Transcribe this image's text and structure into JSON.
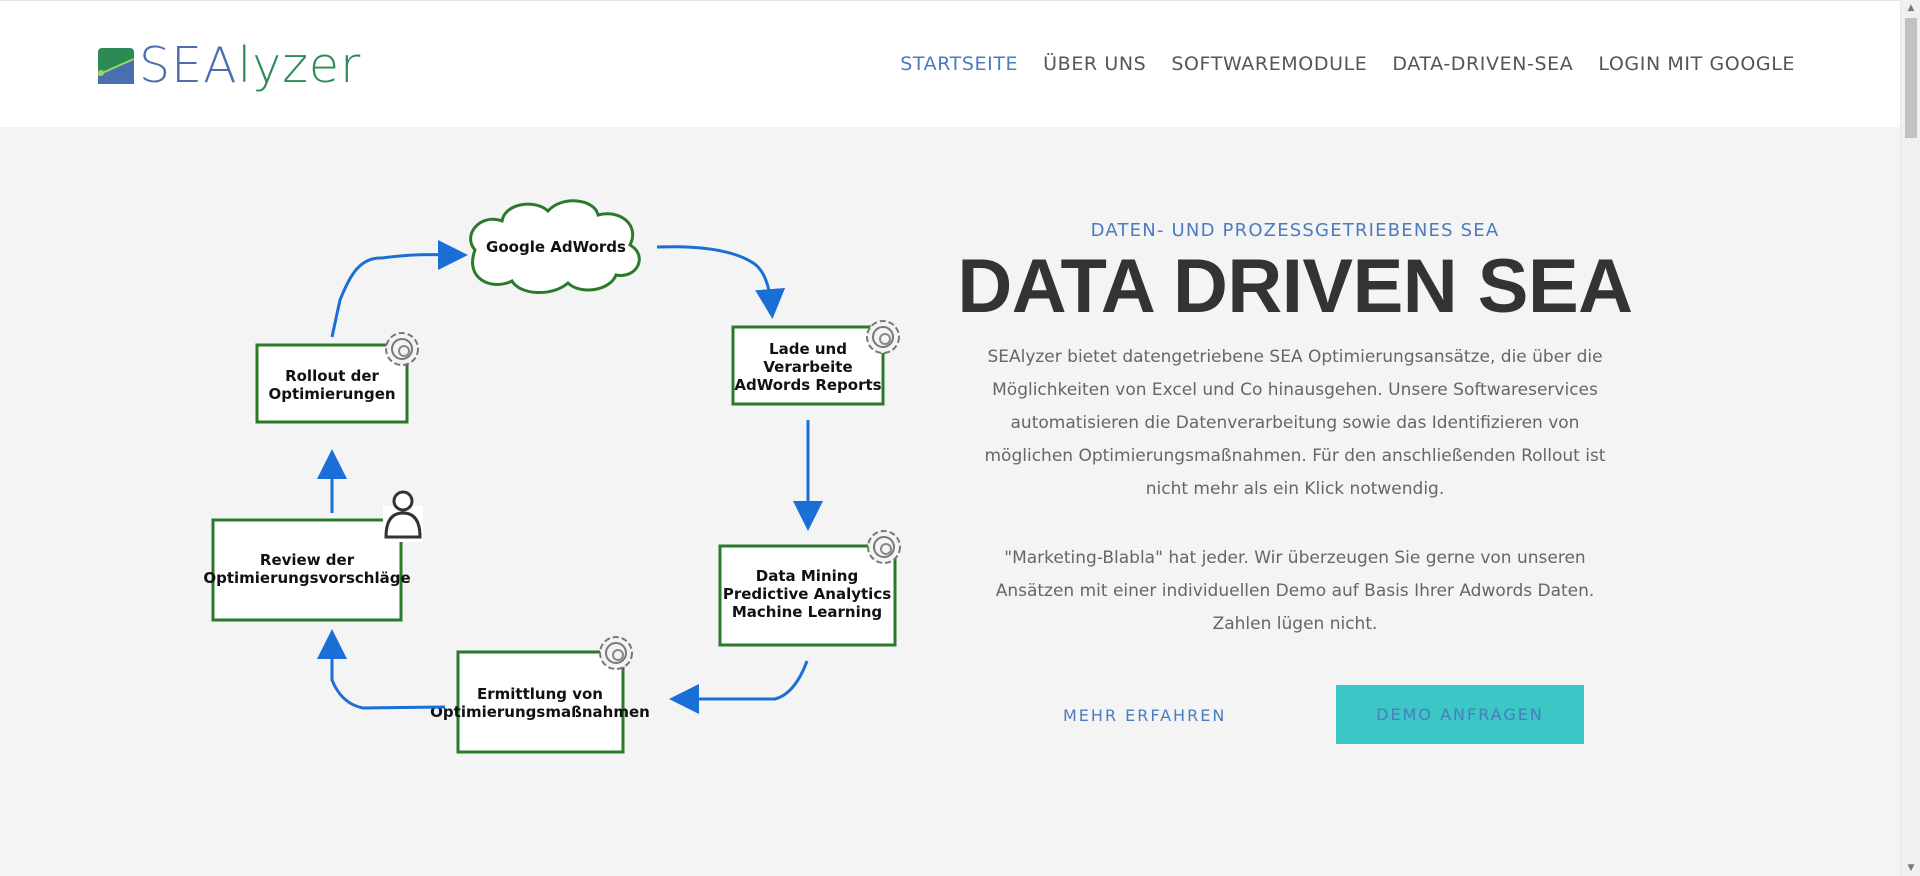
{
  "brand": {
    "sea": "SEA",
    "lyzer": "lyzer"
  },
  "nav": {
    "items": [
      {
        "label": "STARTSEITE",
        "active": true
      },
      {
        "label": "ÜBER UNS",
        "active": false
      },
      {
        "label": "SOFTWAREMODULE",
        "active": false
      },
      {
        "label": "DATA-DRIVEN-SEA",
        "active": false
      },
      {
        "label": "LOGIN MIT GOOGLE",
        "active": false
      }
    ]
  },
  "hero": {
    "eyebrow": "DATEN- UND PROZESSGETRIEBENES SEA",
    "title": "DATA DRIVEN SEA",
    "description": "SEAlyzer bietet datengetriebene SEA Optimierungsansätze, die über die Möglichkeiten von Excel und Co hinausgehen. Unsere Softwareservices automatisieren die Datenverarbeitung sowie das Identifizieren von möglichen Optimierungsmaßnahmen. Für den anschließenden Rollout ist nicht mehr als ein Klick notwendig.",
    "quote": "\"Marketing-Blabla\" hat jeder. Wir überzeugen Sie gerne von unseren Ansätzen mit einer individuellen Demo auf Basis Ihrer Adwords Daten. Zahlen lügen nicht.",
    "more_button": "MEHR ERFAHREN",
    "demo_button": "DEMO ANFRAGEN"
  },
  "diagram": {
    "cloud": "Google AdWords",
    "box_lade": [
      "Lade und",
      "Verarbeite",
      "AdWords Reports"
    ],
    "box_mining": [
      "Data Mining",
      "Predictive Analytics",
      "Machine Learning"
    ],
    "box_ermittlung": [
      "Ermittlung von",
      "Optimierungsmaßnahmen"
    ],
    "box_review": [
      "Review der",
      "Optimierungsvorschläge"
    ],
    "box_rollout": [
      "Rollout der",
      "Optimierungen"
    ]
  },
  "colors": {
    "accent": "#4a7cc0",
    "brand_green": "#2c8a55",
    "demo_button_bg": "#3cc6c6",
    "diagram_green": "#2a7a2a",
    "diagram_arrow": "#1a6fd6"
  },
  "icons": [
    "logo-icon",
    "gear-icon",
    "person-icon",
    "scroll-up-icon",
    "scroll-down-icon"
  ]
}
